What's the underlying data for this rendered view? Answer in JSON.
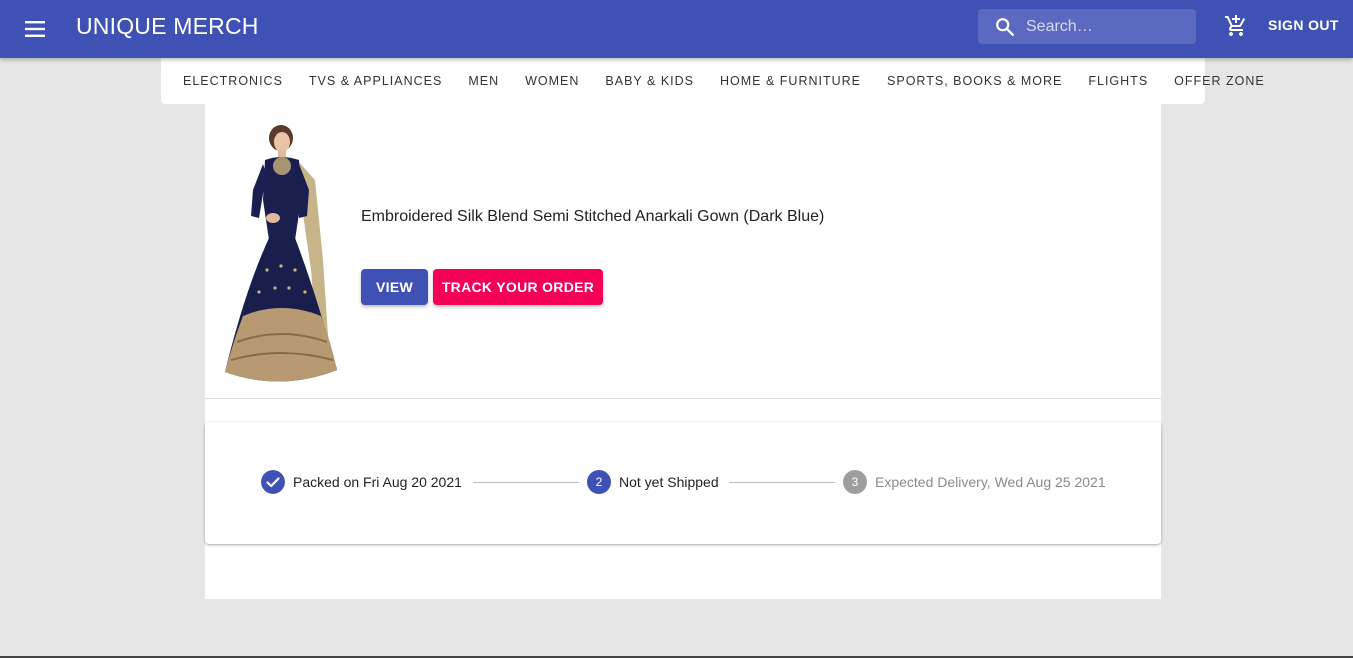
{
  "appbar": {
    "title": "UNIQUE MERCH",
    "search_placeholder": "Search…",
    "signout_label": "SIGN OUT",
    "color": "#3f51b5"
  },
  "categories": [
    "ELECTRONICS",
    "TVS & APPLIANCES",
    "MEN",
    "WOMEN",
    "BABY & KIDS",
    "HOME & FURNITURE",
    "SPORTS, BOOKS & MORE",
    "FLIGHTS",
    "OFFER ZONE"
  ],
  "order": {
    "product_title": "Embroidered Silk Blend Semi Stitched Anarkali Gown (Dark Blue)",
    "view_label": "VIEW",
    "track_label": "TRACK YOUR ORDER",
    "view_color": "#3f51b5",
    "track_color": "#f50057"
  },
  "stepper": {
    "steps": [
      {
        "number": "1",
        "label": "Packed on Fri Aug 20 2021",
        "state": "completed"
      },
      {
        "number": "2",
        "label": "Not yet Shipped",
        "state": "active"
      },
      {
        "number": "3",
        "label": "Expected Delivery, Wed Aug 25 2021",
        "state": "inactive"
      }
    ]
  }
}
